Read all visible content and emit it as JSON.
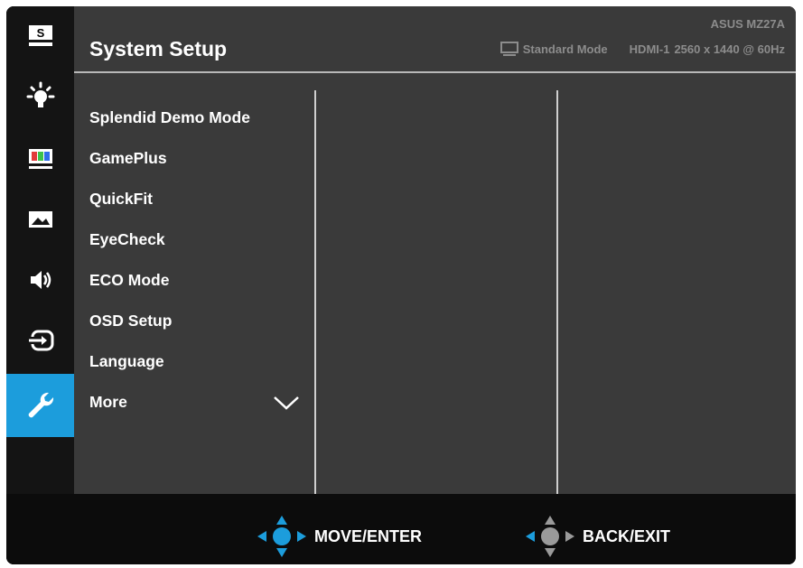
{
  "header": {
    "model": "ASUS MZ27A",
    "title": "System Setup",
    "mode": "Standard Mode",
    "input": "HDMI-1",
    "resolution": "2560 x 1440 @ 60Hz"
  },
  "sidebar": {
    "items": [
      {
        "name": "splendid",
        "icon": "splendid-s-icon",
        "active": false
      },
      {
        "name": "blue-light-filter",
        "icon": "bulb-icon",
        "active": false
      },
      {
        "name": "color",
        "icon": "color-bars-icon",
        "active": false
      },
      {
        "name": "image",
        "icon": "picture-icon",
        "active": false
      },
      {
        "name": "sound",
        "icon": "speaker-icon",
        "active": false
      },
      {
        "name": "input-select",
        "icon": "input-icon",
        "active": false
      },
      {
        "name": "system-setup",
        "icon": "wrench-icon",
        "active": true
      }
    ],
    "active_color": "#1c9ddc"
  },
  "menu": {
    "items": [
      "Splendid Demo Mode",
      "GamePlus",
      "QuickFit",
      "EyeCheck",
      "ECO Mode",
      "OSD Setup",
      "Language",
      "More"
    ],
    "more_icon": "chevron-down-icon"
  },
  "footer": {
    "move_enter": "MOVE/ENTER",
    "back_exit": "BACK/EXIT"
  }
}
